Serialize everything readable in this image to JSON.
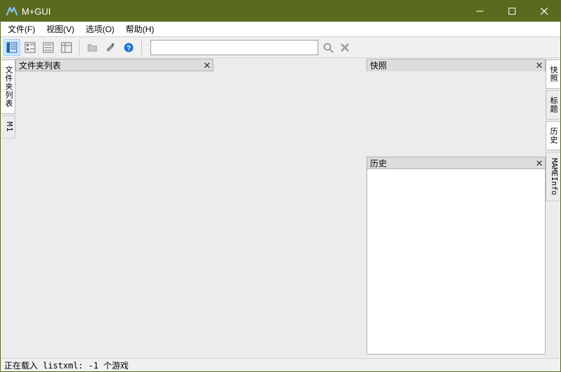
{
  "window": {
    "title": "M+GUI"
  },
  "menu": {
    "file": "文件(F)",
    "view": "视图(V)",
    "options": "选项(O)",
    "help": "帮助(H)"
  },
  "toolbar": {
    "view_large_icons": "large-icons",
    "view_small_icons": "small-icons",
    "view_list": "list",
    "view_details": "details",
    "open_folder": "folder",
    "settings": "settings",
    "about": "about"
  },
  "search": {
    "placeholder": "",
    "value": ""
  },
  "left_tabs": {
    "folders": "文件夹列表",
    "m1": "M1"
  },
  "right_tabs": {
    "snapshot": "快照",
    "title_img": "标题",
    "history": "历史",
    "mameinfo": "MAMEInfo"
  },
  "panes": {
    "folders_title": "文件夹列表",
    "snapshot_title": "快照",
    "history_title": "历史"
  },
  "status": {
    "text": "正在载入 listxml: -1 个游戏"
  },
  "colors": {
    "titlebar": "#5a6b1f",
    "accent": "#1e90ff"
  }
}
